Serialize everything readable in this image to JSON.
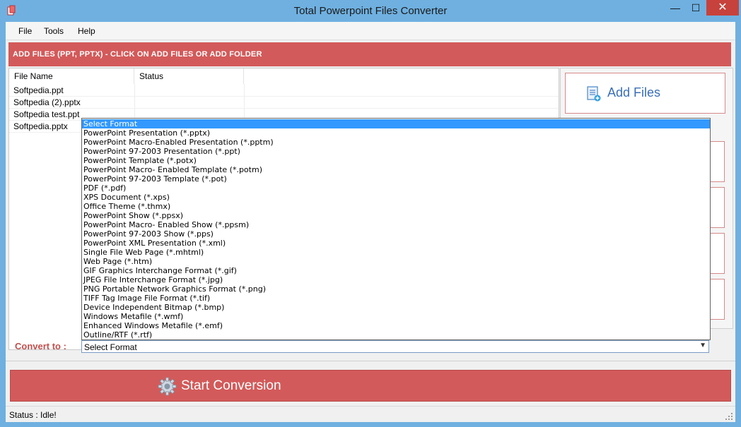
{
  "window": {
    "title": "Total Powerpoint Files Converter",
    "close_glyph": "✕",
    "min_glyph": "—",
    "max_glyph": "☐"
  },
  "menu": {
    "file": "File",
    "tools": "Tools",
    "help": "Help"
  },
  "banner": {
    "text": "ADD FILES (PPT, PPTX) - CLICK ON ADD FILES OR ADD FOLDER"
  },
  "filelist": {
    "columns": [
      "File Name",
      "Status"
    ],
    "rows": [
      {
        "name": "Softpedia.ppt",
        "status": ""
      },
      {
        "name": "Softpedia (2).pptx",
        "status": ""
      },
      {
        "name": "Softpedia test.ppt",
        "status": ""
      },
      {
        "name": "Softpedia.pptx",
        "status": ""
      }
    ]
  },
  "actions": {
    "add_files": "Add Files",
    "add_files_icon": "add-files-icon"
  },
  "convert": {
    "label": "Convert to :",
    "selected": "Select Format",
    "options": [
      "Select Format",
      "PowerPoint Presentation (*.pptx)",
      "PowerPoint Macro-Enabled Presentation (*.pptm)",
      "PowerPoint 97-2003 Presentation (*.ppt)",
      "PowerPoint Template (*.potx)",
      "PowerPoint Macro- Enabled Template (*.potm)",
      "PowerPoint 97-2003 Template (*.pot)",
      "PDF (*.pdf)",
      "XPS Document (*.xps)",
      "Office Theme (*.thmx)",
      "PowerPoint Show (*.ppsx)",
      "PowerPoint Macro- Enabled Show (*.ppsm)",
      "PowerPoint 97-2003 Show (*.pps)",
      "PowerPoint XML Presentation (*.xml)",
      "Single File Web Page (*.mhtml)",
      "Web Page (*.htm)",
      "GIF Graphics Interchange Format (*.gif)",
      "JPEG File Interchange Format (*.jpg)",
      "PNG Portable Network Graphics Format (*.png)",
      "TIFF Tag Image File Format (*.tif)",
      "Device Independent Bitmap (*.bmp)",
      "Windows Metafile (*.wmf)",
      "Enhanced Windows Metafile (*.emf)",
      "Outline/RTF (*.rtf)"
    ]
  },
  "start": {
    "label": "Start Conversion"
  },
  "status": {
    "text": "Status :  Idle!"
  },
  "colors": {
    "accent_red": "#d35a5a",
    "title_blue": "#6fb0e0",
    "select_blue": "#3399ff",
    "label_red": "#c0504d"
  }
}
